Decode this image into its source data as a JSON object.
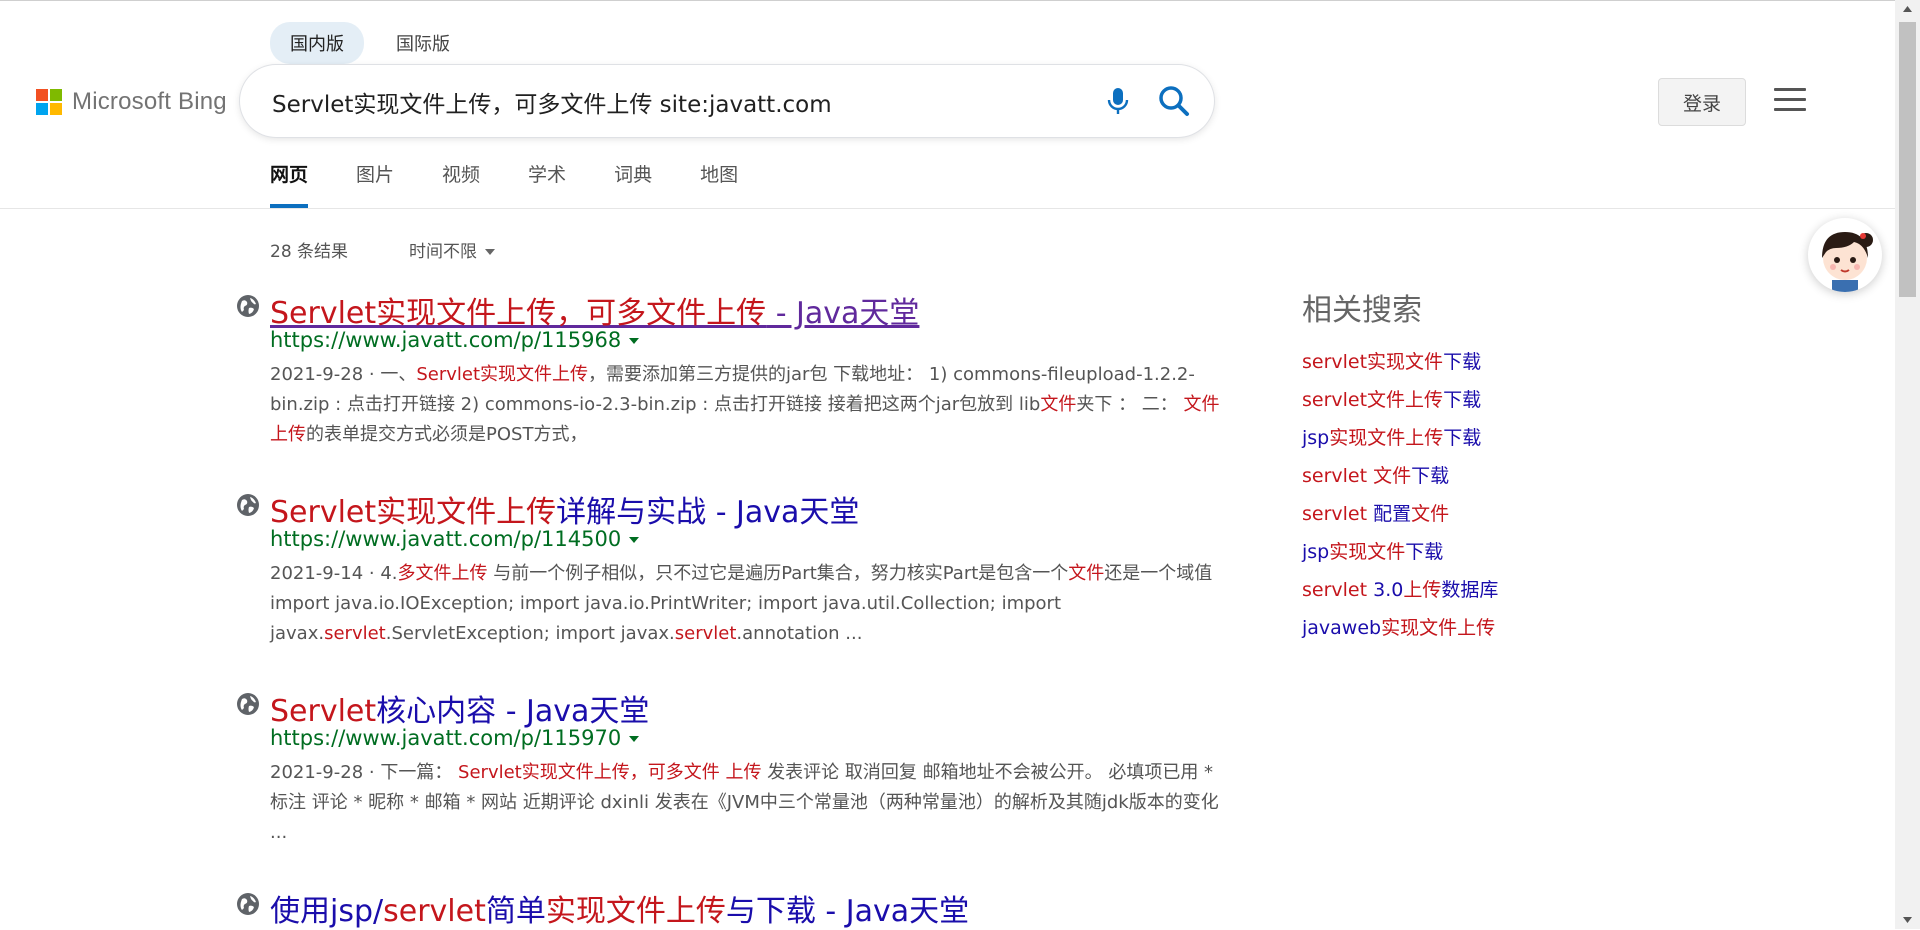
{
  "header": {
    "logo_text": "Microsoft Bing",
    "logo_colors": [
      "#f25022",
      "#7fba00",
      "#00a4ef",
      "#ffb900"
    ],
    "region_tabs": [
      {
        "label": "国内版",
        "active": true
      },
      {
        "label": "国际版",
        "active": false
      }
    ],
    "search": {
      "value": "Servlet实现文件上传，可多文件上传 site:javatt.com"
    },
    "login_label": "登录",
    "nav_tabs": [
      {
        "label": "网页",
        "active": true
      },
      {
        "label": "图片"
      },
      {
        "label": "视频"
      },
      {
        "label": "学术"
      },
      {
        "label": "词典"
      },
      {
        "label": "地图"
      }
    ]
  },
  "results_meta": {
    "count_text": "28 条结果",
    "time_filter": "时间不限"
  },
  "results": [
    {
      "title_parts": [
        {
          "text": "Servlet实现文件上传，可多文件上传",
          "hl": true
        },
        {
          "text": " - Java天堂",
          "hl": false
        }
      ],
      "visited": true,
      "url": "https://www.javatt.com/p/115968",
      "snippet_parts": [
        {
          "text": "2021-9-28 · 一、",
          "hl": false
        },
        {
          "text": "Servlet实现文件上传",
          "hl": true
        },
        {
          "text": "，需要添加第三方提供的jar包 下载地址： 1) commons-fileupload-1.2.2-bin.zip : 点击打开链接 2) commons-io-2.3-bin.zip : 点击打开链接 接着把这两个jar包放到 lib",
          "hl": false
        },
        {
          "text": "文件",
          "hl": true
        },
        {
          "text": "夹下 ： 二： ",
          "hl": false
        },
        {
          "text": "文件上传",
          "hl": true
        },
        {
          "text": "的表单提交方式必须是POST方式，",
          "hl": false
        }
      ]
    },
    {
      "title_parts": [
        {
          "text": "Servlet实现文件上传",
          "hl": true
        },
        {
          "text": "详解与实战 - Java天堂",
          "hl": false
        }
      ],
      "visited": false,
      "url": "https://www.javatt.com/p/114500",
      "snippet_parts": [
        {
          "text": "2021-9-14 · 4.",
          "hl": false
        },
        {
          "text": "多文件上传",
          "hl": true
        },
        {
          "text": " 与前一个例子相似，只不过它是遍历Part集合，努力核实Part是包含一个",
          "hl": false
        },
        {
          "text": "文件",
          "hl": true
        },
        {
          "text": "还是一个域值 import java.io.IOException; import java.io.PrintWriter; import java.util.Collection; import javax.",
          "hl": false
        },
        {
          "text": "servlet",
          "hl": true
        },
        {
          "text": ".ServletException; import javax.",
          "hl": false
        },
        {
          "text": "servlet",
          "hl": true
        },
        {
          "text": ".annotation ...",
          "hl": false
        }
      ]
    },
    {
      "title_parts": [
        {
          "text": "Servlet",
          "hl": true
        },
        {
          "text": "核心内容 - Java天堂",
          "hl": false
        }
      ],
      "visited": false,
      "url": "https://www.javatt.com/p/115970",
      "snippet_parts": [
        {
          "text": "2021-9-28 · 下一篇： ",
          "hl": false
        },
        {
          "text": "Servlet实现文件上传，可多文件 上传",
          "hl": true
        },
        {
          "text": " 发表评论 取消回复 邮箱地址不会被公开。 必填项已用 * 标注 评论 * 昵称 * 邮箱 * 网站 近期评论 dxinli 发表在《JVM中三个常量池（两种常量池）的解析及其随jdk版本的变化 ...",
          "hl": false
        }
      ]
    },
    {
      "title_parts": [
        {
          "text": "使用jsp/",
          "hl": false
        },
        {
          "text": "servlet",
          "hl": true
        },
        {
          "text": "简单",
          "hl": false
        },
        {
          "text": "实现文件上传",
          "hl": true
        },
        {
          "text": "与下载 - Java天堂",
          "hl": false
        }
      ],
      "visited": false,
      "url": "",
      "snippet_parts": []
    }
  ],
  "related": {
    "title": "相关搜索",
    "items": [
      [
        {
          "text": "servlet实现文件",
          "hl": true
        },
        {
          "text": "下载",
          "hl": false
        }
      ],
      [
        {
          "text": "servlet文件上传",
          "hl": true
        },
        {
          "text": "下载",
          "hl": false
        }
      ],
      [
        {
          "text": "jsp",
          "hl": false
        },
        {
          "text": "实现文件上传",
          "hl": true
        },
        {
          "text": "下载",
          "hl": false
        }
      ],
      [
        {
          "text": "servlet 文件",
          "hl": true
        },
        {
          "text": "下载",
          "hl": false
        }
      ],
      [
        {
          "text": "servlet",
          "hl": true
        },
        {
          "text": " 配置",
          "hl": false
        },
        {
          "text": "文件",
          "hl": true
        }
      ],
      [
        {
          "text": "jsp",
          "hl": false
        },
        {
          "text": "实现文件",
          "hl": true
        },
        {
          "text": "下载",
          "hl": false
        }
      ],
      [
        {
          "text": "servlet",
          "hl": true
        },
        {
          "text": " 3.0",
          "hl": false
        },
        {
          "text": "上传",
          "hl": true
        },
        {
          "text": "数据库",
          "hl": false
        }
      ],
      [
        {
          "text": "javaweb",
          "hl": false
        },
        {
          "text": "实现文件上传",
          "hl": true
        }
      ]
    ]
  },
  "icons": {
    "microphone": "microphone-icon",
    "search": "search-icon",
    "menu": "hamburger-menu-icon",
    "globe": "globe-icon",
    "avatar": "assistant-avatar"
  },
  "colors": {
    "link": "#1a0dab",
    "visited": "#60299c",
    "highlight": "#c4161c",
    "url": "#006d21",
    "accent": "#0c6fbf"
  }
}
